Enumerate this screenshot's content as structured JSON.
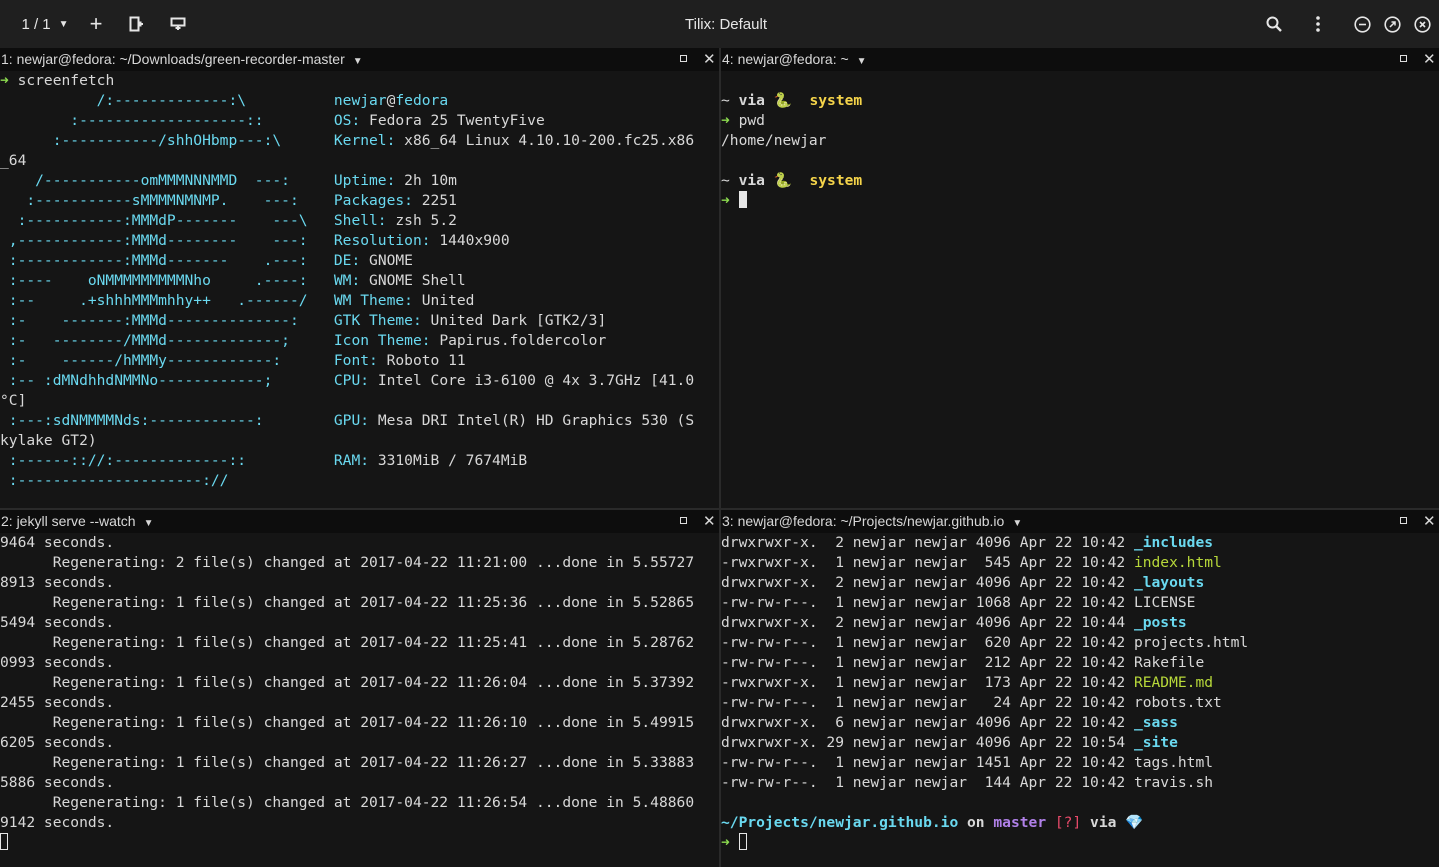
{
  "window": {
    "title": "Tilix: Default",
    "session_counter": "1 / 1"
  },
  "panes": [
    {
      "header": "1: newjar@fedora: ~/Downloads/green-recorder-master",
      "lines": [
        [
          {
            "t": "➜ ",
            "c": "green"
          },
          {
            "t": "screenfetch"
          }
        ],
        [
          {
            "t": "           /:-------------:\\          ",
            "c": "cyan"
          },
          {
            "t": "newjar",
            "c": "cyan"
          },
          {
            "t": "@"
          },
          {
            "t": "fedora",
            "c": "cyan"
          }
        ],
        [
          {
            "t": "        :-------------------::        ",
            "c": "cyan"
          },
          {
            "t": "OS: ",
            "c": "cyan"
          },
          {
            "t": "Fedora 25 TwentyFive"
          }
        ],
        [
          {
            "t": "      :-----------/shhOHbmp---:\\      ",
            "c": "cyan"
          },
          {
            "t": "Kernel: ",
            "c": "cyan"
          },
          {
            "t": "x86_64 Linux 4.10.10-200.fc25.x86"
          }
        ],
        [
          {
            "t": "_64"
          }
        ],
        [
          {
            "t": "    /-----------omMMMNNNMMD  ---:     ",
            "c": "cyan"
          },
          {
            "t": "Uptime: ",
            "c": "cyan"
          },
          {
            "t": "2h 10m"
          }
        ],
        [
          {
            "t": "   :-----------sMMMMNMNMP.    ---:    ",
            "c": "cyan"
          },
          {
            "t": "Packages: ",
            "c": "cyan"
          },
          {
            "t": "2251"
          }
        ],
        [
          {
            "t": "  :-----------:MMMdP-------    ---\\   ",
            "c": "cyan"
          },
          {
            "t": "Shell: ",
            "c": "cyan"
          },
          {
            "t": "zsh 5.2"
          }
        ],
        [
          {
            "t": " ,------------:MMMd--------    ---:   ",
            "c": "cyan"
          },
          {
            "t": "Resolution: ",
            "c": "cyan"
          },
          {
            "t": "1440x900"
          }
        ],
        [
          {
            "t": " :------------:MMMd-------    .---:   ",
            "c": "cyan"
          },
          {
            "t": "DE: ",
            "c": "cyan"
          },
          {
            "t": "GNOME"
          }
        ],
        [
          {
            "t": " :----    oNMMMMMMMMMNho     .----:   ",
            "c": "cyan"
          },
          {
            "t": "WM: ",
            "c": "cyan"
          },
          {
            "t": "GNOME Shell"
          }
        ],
        [
          {
            "t": " :--     .+shhhMMMmhhy++   .------/   ",
            "c": "cyan"
          },
          {
            "t": "WM Theme: ",
            "c": "cyan"
          },
          {
            "t": "United"
          }
        ],
        [
          {
            "t": " :-    -------:MMMd--------------:    ",
            "c": "cyan"
          },
          {
            "t": "GTK Theme: ",
            "c": "cyan"
          },
          {
            "t": "United Dark [GTK2/3]"
          }
        ],
        [
          {
            "t": " :-   --------/MMMd-------------;     ",
            "c": "cyan"
          },
          {
            "t": "Icon Theme: ",
            "c": "cyan"
          },
          {
            "t": "Papirus.foldercolor"
          }
        ],
        [
          {
            "t": " :-    ------/hMMMy------------:      ",
            "c": "cyan"
          },
          {
            "t": "Font: ",
            "c": "cyan"
          },
          {
            "t": "Roboto 11"
          }
        ],
        [
          {
            "t": " :-- :dMNdhhdNMMNo------------;       ",
            "c": "cyan"
          },
          {
            "t": "CPU: ",
            "c": "cyan"
          },
          {
            "t": "Intel Core i3-6100 @ 4x 3.7GHz [41.0"
          }
        ],
        [
          {
            "t": "°C]"
          }
        ],
        [
          {
            "t": " :---:sdNMMMMNds:------------:        ",
            "c": "cyan"
          },
          {
            "t": "GPU: ",
            "c": "cyan"
          },
          {
            "t": "Mesa DRI Intel(R) HD Graphics 530 (S"
          }
        ],
        [
          {
            "t": "kylake GT2)"
          }
        ],
        [
          {
            "t": " :------:://:-------------::          ",
            "c": "cyan"
          },
          {
            "t": "RAM: ",
            "c": "cyan"
          },
          {
            "t": "3310MiB / 7674MiB"
          }
        ],
        [
          {
            "t": " :---------------------://            ",
            "c": "cyan"
          }
        ]
      ]
    },
    {
      "header": "4: newjar@fedora: ~",
      "lines": [
        [
          {
            "t": ""
          }
        ],
        [
          {
            "t": "~ ",
            "c": "plain"
          },
          {
            "t": "via ",
            "c": "plainb"
          },
          {
            "t": "🐍 ",
            "c": "orange"
          },
          {
            "t": " system",
            "c": "yellow"
          }
        ],
        [
          {
            "t": "➜ ",
            "c": "green"
          },
          {
            "t": "pwd"
          }
        ],
        [
          {
            "t": "/home/newjar"
          }
        ],
        [
          {
            "t": ""
          }
        ],
        [
          {
            "t": "~ ",
            "c": "plain"
          },
          {
            "t": "via ",
            "c": "plainb"
          },
          {
            "t": "🐍 ",
            "c": "orange"
          },
          {
            "t": " system",
            "c": "yellow"
          }
        ],
        [
          {
            "t": "➜ ",
            "c": "green"
          },
          {
            "t": "",
            "cursor": "solid"
          }
        ]
      ]
    },
    {
      "header": "2: jekyll serve --watch",
      "lines": [
        [
          {
            "t": "9464 seconds."
          }
        ],
        [
          {
            "t": "      Regenerating: 2 file(s) changed at 2017-04-22 11:21:00 ...done in 5.55727"
          }
        ],
        [
          {
            "t": "8913 seconds."
          }
        ],
        [
          {
            "t": "      Regenerating: 1 file(s) changed at 2017-04-22 11:25:36 ...done in 5.52865"
          }
        ],
        [
          {
            "t": "5494 seconds."
          }
        ],
        [
          {
            "t": "      Regenerating: 1 file(s) changed at 2017-04-22 11:25:41 ...done in 5.28762"
          }
        ],
        [
          {
            "t": "0993 seconds."
          }
        ],
        [
          {
            "t": "      Regenerating: 1 file(s) changed at 2017-04-22 11:26:04 ...done in 5.37392"
          }
        ],
        [
          {
            "t": "2455 seconds."
          }
        ],
        [
          {
            "t": "      Regenerating: 1 file(s) changed at 2017-04-22 11:26:10 ...done in 5.49915"
          }
        ],
        [
          {
            "t": "6205 seconds."
          }
        ],
        [
          {
            "t": "      Regenerating: 1 file(s) changed at 2017-04-22 11:26:27 ...done in 5.33883"
          }
        ],
        [
          {
            "t": "5886 seconds."
          }
        ],
        [
          {
            "t": "      Regenerating: 1 file(s) changed at 2017-04-22 11:26:54 ...done in 5.48860"
          }
        ],
        [
          {
            "t": "9142 seconds."
          }
        ],
        [
          {
            "t": "",
            "cursor": "hollow"
          }
        ]
      ]
    },
    {
      "header": "3: newjar@fedora: ~/Projects/newjar.github.io",
      "lines": [
        [
          {
            "t": "drwxrwxr-x.  2 newjar newjar 4096 Apr 22 10:42 "
          },
          {
            "t": "_includes",
            "c": "blue"
          }
        ],
        [
          {
            "t": "-rwxrwxr-x.  1 newjar newjar  545 Apr 22 10:42 "
          },
          {
            "t": "index.html",
            "c": "lime"
          }
        ],
        [
          {
            "t": "drwxrwxr-x.  2 newjar newjar 4096 Apr 22 10:42 "
          },
          {
            "t": "_layouts",
            "c": "blue"
          }
        ],
        [
          {
            "t": "-rw-rw-r--.  1 newjar newjar 1068 Apr 22 10:42 LICENSE"
          }
        ],
        [
          {
            "t": "drwxrwxr-x.  2 newjar newjar 4096 Apr 22 10:44 "
          },
          {
            "t": "_posts",
            "c": "blue"
          }
        ],
        [
          {
            "t": "-rw-rw-r--.  1 newjar newjar  620 Apr 22 10:42 projects.html"
          }
        ],
        [
          {
            "t": "-rw-rw-r--.  1 newjar newjar  212 Apr 22 10:42 Rakefile"
          }
        ],
        [
          {
            "t": "-rwxrwxr-x.  1 newjar newjar  173 Apr 22 10:42 "
          },
          {
            "t": "README.md",
            "c": "lime"
          }
        ],
        [
          {
            "t": "-rw-rw-r--.  1 newjar newjar   24 Apr 22 10:42 robots.txt"
          }
        ],
        [
          {
            "t": "drwxrwxr-x.  6 newjar newjar 4096 Apr 22 10:42 "
          },
          {
            "t": "_sass",
            "c": "blue"
          }
        ],
        [
          {
            "t": "drwxrwxr-x. 29 newjar newjar 4096 Apr 22 10:54 "
          },
          {
            "t": "_site",
            "c": "blue"
          }
        ],
        [
          {
            "t": "-rw-rw-r--.  1 newjar newjar 1451 Apr 22 10:42 tags.html"
          }
        ],
        [
          {
            "t": "-rw-rw-r--.  1 newjar newjar  144 Apr 22 10:42 travis.sh"
          }
        ],
        [
          {
            "t": ""
          }
        ],
        [
          {
            "t": "~/Projects/newjar.github.io",
            "c": "bcyan"
          },
          {
            "t": " on ",
            "c": "plainb"
          },
          {
            "t": "master",
            "c": "purple"
          },
          {
            "t": " [?] ",
            "c": "red"
          },
          {
            "t": "via ",
            "c": "plainb"
          },
          {
            "t": "💎",
            "c": "red"
          }
        ],
        [
          {
            "t": "➜ ",
            "c": "green"
          },
          {
            "t": "",
            "cursor": "hollow"
          }
        ]
      ]
    }
  ]
}
